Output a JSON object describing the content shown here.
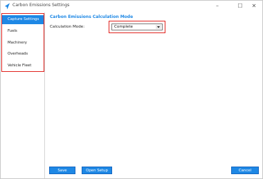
{
  "window": {
    "title": "Carbon Emissions Settings"
  },
  "controls": {
    "minimize": "–",
    "maximize": "☐",
    "close": "✕"
  },
  "sidebar": {
    "items": [
      {
        "label": "Capture Settings",
        "active": true
      },
      {
        "label": "Fuels",
        "active": false
      },
      {
        "label": "Machinery",
        "active": false
      },
      {
        "label": "Overheads",
        "active": false
      },
      {
        "label": "Vehicle Fleet",
        "active": false
      }
    ]
  },
  "main": {
    "section_title": "Carbon Emissions Calculation Mode",
    "calculation_mode": {
      "label": "Calculation Mode:",
      "value": "Complete"
    }
  },
  "footer": {
    "save_label": "Save",
    "open_setup_label": "Open Setup",
    "cancel_label": "Cancel"
  },
  "colors": {
    "accent": "#1e88e5",
    "highlight_border": "#e0201c"
  }
}
